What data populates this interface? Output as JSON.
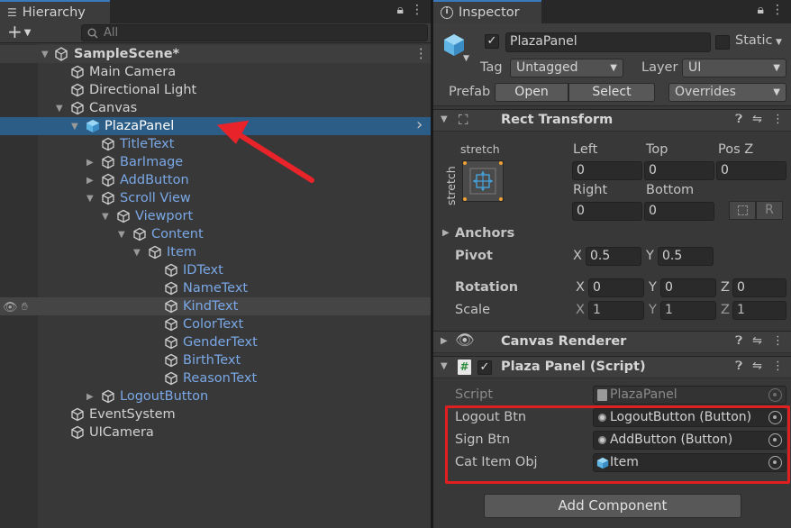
{
  "hierarchy": {
    "tab_label": "Hierarchy",
    "add_label": "+",
    "search_placeholder": "All",
    "scene_name": "SampleScene*",
    "items": [
      {
        "label": "Main Camera"
      },
      {
        "label": "Directional Light"
      },
      {
        "label": "Canvas"
      },
      {
        "label": "PlazaPanel"
      },
      {
        "label": "TitleText"
      },
      {
        "label": "BarImage"
      },
      {
        "label": "AddButton"
      },
      {
        "label": "Scroll View"
      },
      {
        "label": "Viewport"
      },
      {
        "label": "Content"
      },
      {
        "label": "Item"
      },
      {
        "label": "IDText"
      },
      {
        "label": "NameText"
      },
      {
        "label": "KindText"
      },
      {
        "label": "ColorText"
      },
      {
        "label": "GenderText"
      },
      {
        "label": "BirthText"
      },
      {
        "label": "ReasonText"
      },
      {
        "label": "LogoutButton"
      },
      {
        "label": "EventSystem"
      },
      {
        "label": "UICamera"
      }
    ]
  },
  "inspector": {
    "tab_label": "Inspector",
    "object_name": "PlazaPanel",
    "static_label": "Static",
    "tag_label": "Tag",
    "tag_value": "Untagged",
    "layer_label": "Layer",
    "layer_value": "UI",
    "prefab_label": "Prefab",
    "open_label": "Open",
    "select_label": "Select",
    "overrides_label": "Overrides",
    "rect_transform": {
      "title": "Rect Transform",
      "anchor_preset": "stretch",
      "left_label": "Left",
      "left": "0",
      "top_label": "Top",
      "top": "0",
      "posz_label": "Pos Z",
      "posz": "0",
      "right_label": "Right",
      "right": "0",
      "bottom_label": "Bottom",
      "bottom": "0",
      "raw_label": "R",
      "anchors_label": "Anchors",
      "pivot_label": "Pivot",
      "pivot_x": "0.5",
      "pivot_y": "0.5",
      "rotation_label": "Rotation",
      "rot_x": "0",
      "rot_y": "0",
      "rot_z": "0",
      "scale_label": "Scale",
      "scale_x": "1",
      "scale_y": "1",
      "scale_z": "1",
      "x": "X",
      "y": "Y",
      "z": "Z"
    },
    "canvas_renderer": {
      "title": "Canvas Renderer"
    },
    "script_component": {
      "title": "Plaza Panel (Script)",
      "script_label": "Script",
      "script_value": "PlazaPanel",
      "fields": [
        {
          "label": "Logout Btn",
          "value": "LogoutButton (Button)"
        },
        {
          "label": "Sign Btn",
          "value": "AddButton (Button)"
        },
        {
          "label": "Cat Item Obj",
          "value": "Item"
        }
      ]
    },
    "add_component_label": "Add Component"
  },
  "colors": {
    "selection": "#2c5d87",
    "highlight_box": "#e02020",
    "arrow": "#e8242a",
    "prefab_blue": "#7aa8e6"
  }
}
